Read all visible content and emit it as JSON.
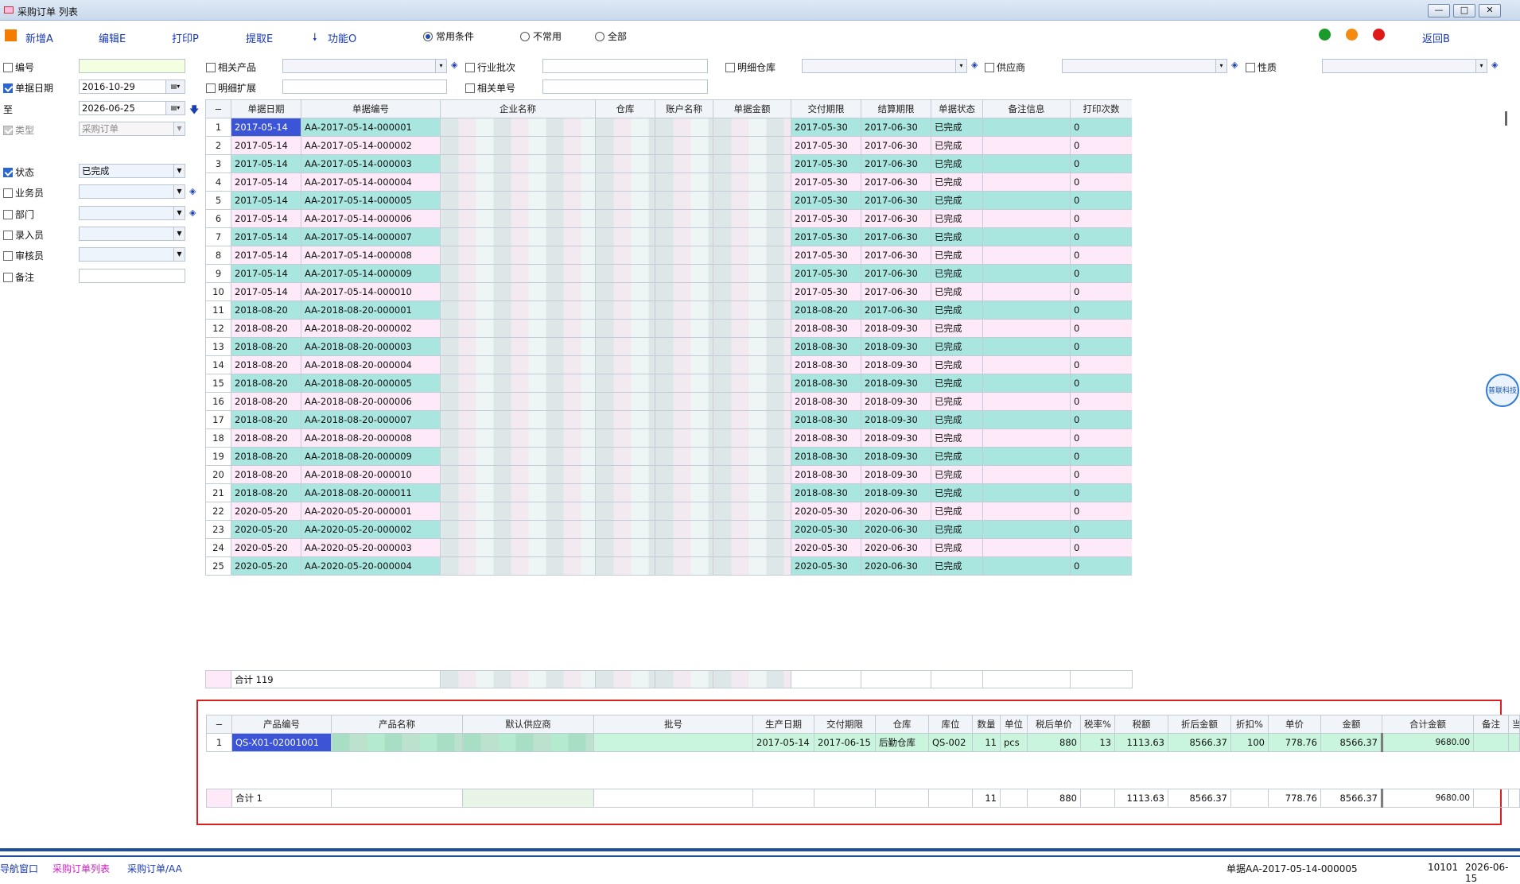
{
  "window": {
    "title": "采购订单 列表",
    "min": "—",
    "max": "□",
    "close": "✕"
  },
  "toolbar": {
    "add": "新增A",
    "edit": "编辑E",
    "print": "打印P",
    "extract": "提取E",
    "func": "功能O",
    "back": "返回B"
  },
  "filter_scope": {
    "common": "常用条件",
    "uncommon": "不常用",
    "all": "全部"
  },
  "status_dots": {
    "green": "#1a9a2a",
    "orange": "#f58a10",
    "red": "#e01818"
  },
  "left_filters": {
    "code_label": "编号",
    "date_label": "单据日期",
    "date_from": "2016-10-29",
    "to_label": "至",
    "date_to": "2026-06-25",
    "type_label": "类型",
    "type_value": "采购订单",
    "status_label": "状态",
    "status_value": "已完成",
    "clerk_label": "业务员",
    "dept_label": "部门",
    "entry_label": "录入员",
    "audit_label": "审核员",
    "remark_label": "备注"
  },
  "top_filters": {
    "related_product": "相关产品",
    "industry_batch": "行业批次",
    "detail_wh": "明细仓库",
    "supplier": "供应商",
    "nature": "性质",
    "detail_ext": "明细扩展",
    "related_no": "相关单号"
  },
  "main_grid": {
    "corner": "−",
    "columns": [
      "单据日期",
      "单据编号",
      "企业名称",
      "仓库",
      "账户名称",
      "单据金额",
      "交付期限",
      "结算期限",
      "单据状态",
      "备注信息",
      "打印次数"
    ],
    "rows": [
      [
        "1",
        "2017-05-14",
        "AA-2017-05-14-000001",
        "2017-05-30",
        "2017-06-30",
        "已完成",
        "0"
      ],
      [
        "2",
        "2017-05-14",
        "AA-2017-05-14-000002",
        "2017-05-30",
        "2017-06-30",
        "已完成",
        "0"
      ],
      [
        "3",
        "2017-05-14",
        "AA-2017-05-14-000003",
        "2017-05-30",
        "2017-06-30",
        "已完成",
        "0"
      ],
      [
        "4",
        "2017-05-14",
        "AA-2017-05-14-000004",
        "2017-05-30",
        "2017-06-30",
        "已完成",
        "0"
      ],
      [
        "5",
        "2017-05-14",
        "AA-2017-05-14-000005",
        "2017-05-30",
        "2017-06-30",
        "已完成",
        "0"
      ],
      [
        "6",
        "2017-05-14",
        "AA-2017-05-14-000006",
        "2017-05-30",
        "2017-06-30",
        "已完成",
        "0"
      ],
      [
        "7",
        "2017-05-14",
        "AA-2017-05-14-000007",
        "2017-05-30",
        "2017-06-30",
        "已完成",
        "0"
      ],
      [
        "8",
        "2017-05-14",
        "AA-2017-05-14-000008",
        "2017-05-30",
        "2017-06-30",
        "已完成",
        "0"
      ],
      [
        "9",
        "2017-05-14",
        "AA-2017-05-14-000009",
        "2017-05-30",
        "2017-06-30",
        "已完成",
        "0"
      ],
      [
        "10",
        "2017-05-14",
        "AA-2017-05-14-000010",
        "2017-05-30",
        "2017-06-30",
        "已完成",
        "0"
      ],
      [
        "11",
        "2018-08-20",
        "AA-2018-08-20-000001",
        "2018-08-20",
        "2017-06-30",
        "已完成",
        "0"
      ],
      [
        "12",
        "2018-08-20",
        "AA-2018-08-20-000002",
        "2018-08-30",
        "2018-09-30",
        "已完成",
        "0"
      ],
      [
        "13",
        "2018-08-20",
        "AA-2018-08-20-000003",
        "2018-08-30",
        "2018-09-30",
        "已完成",
        "0"
      ],
      [
        "14",
        "2018-08-20",
        "AA-2018-08-20-000004",
        "2018-08-30",
        "2018-09-30",
        "已完成",
        "0"
      ],
      [
        "15",
        "2018-08-20",
        "AA-2018-08-20-000005",
        "2018-08-30",
        "2018-09-30",
        "已完成",
        "0"
      ],
      [
        "16",
        "2018-08-20",
        "AA-2018-08-20-000006",
        "2018-08-30",
        "2018-09-30",
        "已完成",
        "0"
      ],
      [
        "17",
        "2018-08-20",
        "AA-2018-08-20-000007",
        "2018-08-30",
        "2018-09-30",
        "已完成",
        "0"
      ],
      [
        "18",
        "2018-08-20",
        "AA-2018-08-20-000008",
        "2018-08-30",
        "2018-09-30",
        "已完成",
        "0"
      ],
      [
        "19",
        "2018-08-20",
        "AA-2018-08-20-000009",
        "2018-08-30",
        "2018-09-30",
        "已完成",
        "0"
      ],
      [
        "20",
        "2018-08-20",
        "AA-2018-08-20-000010",
        "2018-08-30",
        "2018-09-30",
        "已完成",
        "0"
      ],
      [
        "21",
        "2018-08-20",
        "AA-2018-08-20-000011",
        "2018-08-30",
        "2018-09-30",
        "已完成",
        "0"
      ],
      [
        "22",
        "2020-05-20",
        "AA-2020-05-20-000001",
        "2020-05-30",
        "2020-06-30",
        "已完成",
        "0"
      ],
      [
        "23",
        "2020-05-20",
        "AA-2020-05-20-000002",
        "2020-05-30",
        "2020-06-30",
        "已完成",
        "0"
      ],
      [
        "24",
        "2020-05-20",
        "AA-2020-05-20-000003",
        "2020-05-30",
        "2020-06-30",
        "已完成",
        "0"
      ],
      [
        "25",
        "2020-05-20",
        "AA-2020-05-20-000004",
        "2020-05-30",
        "2020-06-30",
        "已完成",
        "0"
      ]
    ],
    "total": "合计 119"
  },
  "detail_grid": {
    "corner": "−",
    "columns": [
      "产品编号",
      "产品名称",
      "默认供应商",
      "批号",
      "生产日期",
      "交付期限",
      "仓库",
      "库位",
      "数量",
      "单位",
      "税后单价",
      "税率%",
      "税额",
      "折后金额",
      "折扣%",
      "单价",
      "金额",
      "合计金额",
      "备注",
      "当"
    ],
    "row": {
      "no": "1",
      "code": "QS-X01-02001001",
      "prod_date": "2017-05-14",
      "deliver": "2017-06-15",
      "wh": "后勤仓库",
      "loc": "QS-002",
      "qty": "11",
      "unit": "pcs",
      "tax_price": "880",
      "tax_rate": "13",
      "tax_amt": "1113.63",
      "disc_amt": "8566.37",
      "disc": "100",
      "price": "778.76",
      "amount": "8566.37",
      "total": "9680.00"
    },
    "sum": {
      "label": "合计 1",
      "qty": "11",
      "tax_price": "880",
      "tax_amt": "1113.63",
      "disc_amt": "8566.37",
      "price": "778.76",
      "amount": "8566.37",
      "total": "9680.00"
    }
  },
  "statusbar": {
    "nav": "导航窗口",
    "tab1": "采购订单列表",
    "tab2": "采购订单/AA",
    "doc": "单据AA-2017-05-14-000005",
    "code": "10101",
    "date": "2026-06-15"
  },
  "badge": "普联科技"
}
